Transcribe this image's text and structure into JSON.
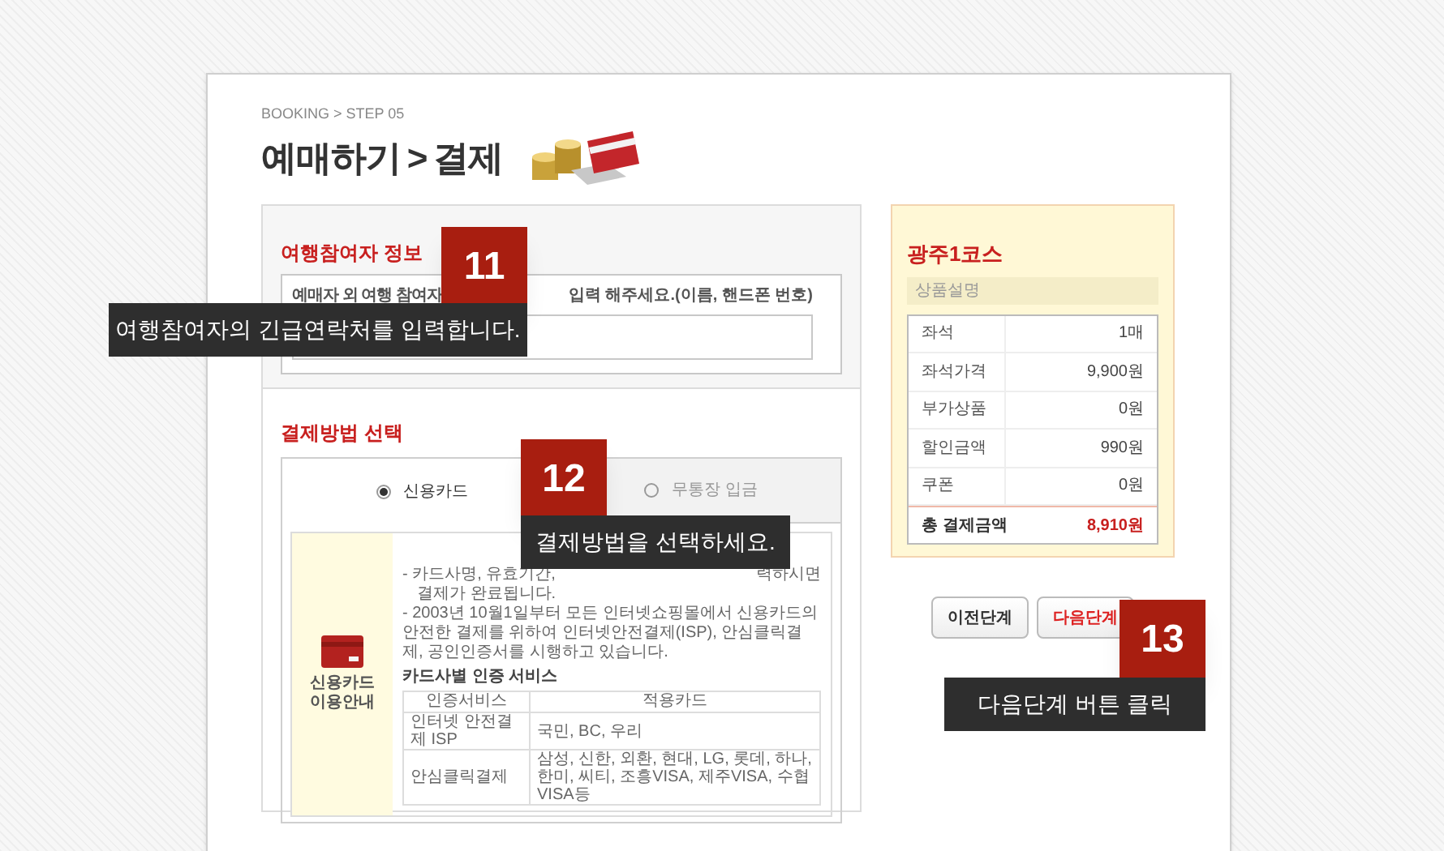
{
  "breadcrumb": "BOOKING > STEP 05",
  "title": {
    "main": "예매하기",
    "separator": ">",
    "sub": "결제"
  },
  "traveler_section": {
    "title": "여행참여자 정보",
    "instruction_start": "예매자 외 여행 참여자",
    "instruction_end": "입력 해주세요.(이름, 핸드폰 번호)"
  },
  "payment_section": {
    "title": "결제방법 선택",
    "methods": [
      {
        "label": "신용카드",
        "selected": true
      },
      {
        "label": "무통장 입금",
        "selected": false
      }
    ],
    "guide_label": "신용카드 이용안내",
    "notes": [
      {
        "start": "- 카드사명, 유효기간,",
        "end": "력하시면",
        "continuation": "결제가 완료됩니다."
      },
      {
        "start": "- 2003년 10월1일부터 모든 인터넷쇼핑몰에서 신용카드의 안전한 결제를 위하여 인터넷안전결제(ISP), 안심클릭결제, 공인인증서를 시행하고 있습니다."
      }
    ],
    "auth_title": "카드사별 인증 서비스",
    "auth_table": {
      "columns": [
        "인증서비스",
        "적용카드"
      ],
      "rows": [
        [
          "인터넷 안전결제 ISP",
          "국민, BC, 우리"
        ],
        [
          "안심클릭결제",
          "삼성, 신한, 외환, 현대, LG, 롯데, 하나, 한미, 씨티, 조흥VISA, 제주VISA, 수협VISA등"
        ]
      ]
    }
  },
  "summary": {
    "title": "광주1코스",
    "subtitle": "상품설명",
    "rows": [
      {
        "label": "좌석",
        "value": "1매"
      },
      {
        "label": "좌석가격",
        "value": "9,900원"
      },
      {
        "label": "부가상품",
        "value": "0원"
      },
      {
        "label": "할인금액",
        "value": "990원"
      },
      {
        "label": "쿠폰",
        "value": "0원"
      }
    ],
    "total": {
      "label": "총 결제금액",
      "value": "8,910원"
    }
  },
  "buttons": [
    {
      "label": "이전단계",
      "kind": "default"
    },
    {
      "label": "다음단계",
      "kind": "primary"
    }
  ],
  "callouts": [
    {
      "number": "11",
      "text": "여행참여자의 긴급연락처를 입력합니다."
    },
    {
      "number": "12",
      "text": "결제방법을 선택하세요."
    },
    {
      "number": "13",
      "text": "다음단계 버튼 클릭"
    }
  ]
}
